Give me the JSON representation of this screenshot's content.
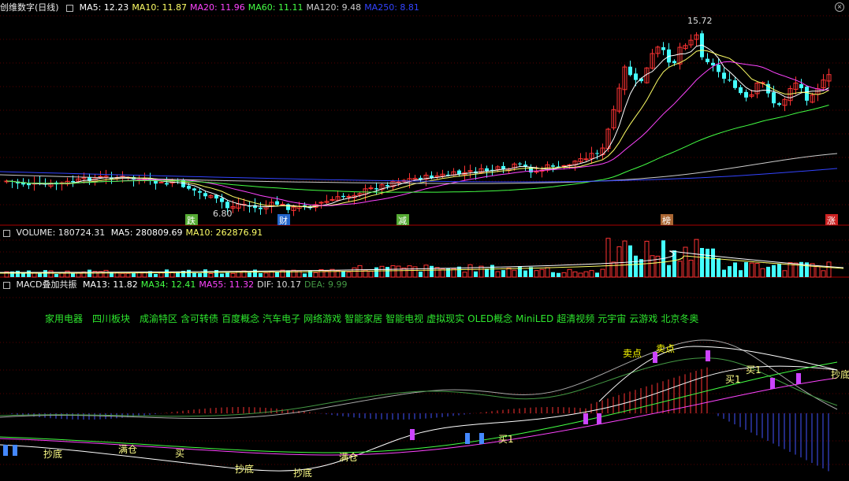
{
  "main": {
    "title": "创维数字(日线)",
    "ma": [
      {
        "label": "MA5: 12.23",
        "color": "#ffffff"
      },
      {
        "label": "MA10: 11.87",
        "color": "#ffff66"
      },
      {
        "label": "MA20: 11.96",
        "color": "#ff44ff"
      },
      {
        "label": "MA60: 11.11",
        "color": "#44ff44"
      },
      {
        "label": "MA120: 9.48",
        "color": "#cccccc"
      },
      {
        "label": "MA250: 8.81",
        "color": "#3344ff"
      }
    ],
    "high_label": "15.72",
    "low_label": "6.80",
    "markers": [
      "跌",
      "财",
      "减",
      "榜",
      "涨"
    ]
  },
  "volume": {
    "title": "VOLUME: 180724.31",
    "ma": [
      {
        "label": "MA5: 280809.69",
        "color": "#ffffff"
      },
      {
        "label": "MA10: 262876.91",
        "color": "#ffff66"
      }
    ]
  },
  "macd": {
    "title": "MACD叠加共振",
    "ma": [
      {
        "label": "MA13: 11.82",
        "color": "#ffffff"
      },
      {
        "label": "MA34: 12.41",
        "color": "#44ff44"
      },
      {
        "label": "MA55: 11.32",
        "color": "#ff44ff"
      },
      {
        "label": "DIF: 10.17",
        "color": "#dddddd"
      },
      {
        "label": "DEA: 9.99",
        "color": "#449944"
      }
    ],
    "concepts": [
      "家用电器",
      "四川板块",
      "成渝特区",
      "含可转债",
      "百度概念",
      "汽车电子",
      "网络游戏",
      "智能家居",
      "智能电视",
      "虚拟现实",
      "OLED概念",
      "MiniLED",
      "超清视频",
      "元宇宙",
      "云游戏",
      "北京冬奥"
    ],
    "signals": {
      "chaodi": "抄底",
      "mancang": "满仓",
      "mai": "买",
      "mai1": "买1",
      "maidian": "卖点",
      "chaodi2": "抄底"
    }
  },
  "colors": {
    "up": "#ff3333",
    "down": "#44ffff",
    "signal": "#ffff00",
    "grid": "#880000"
  }
}
